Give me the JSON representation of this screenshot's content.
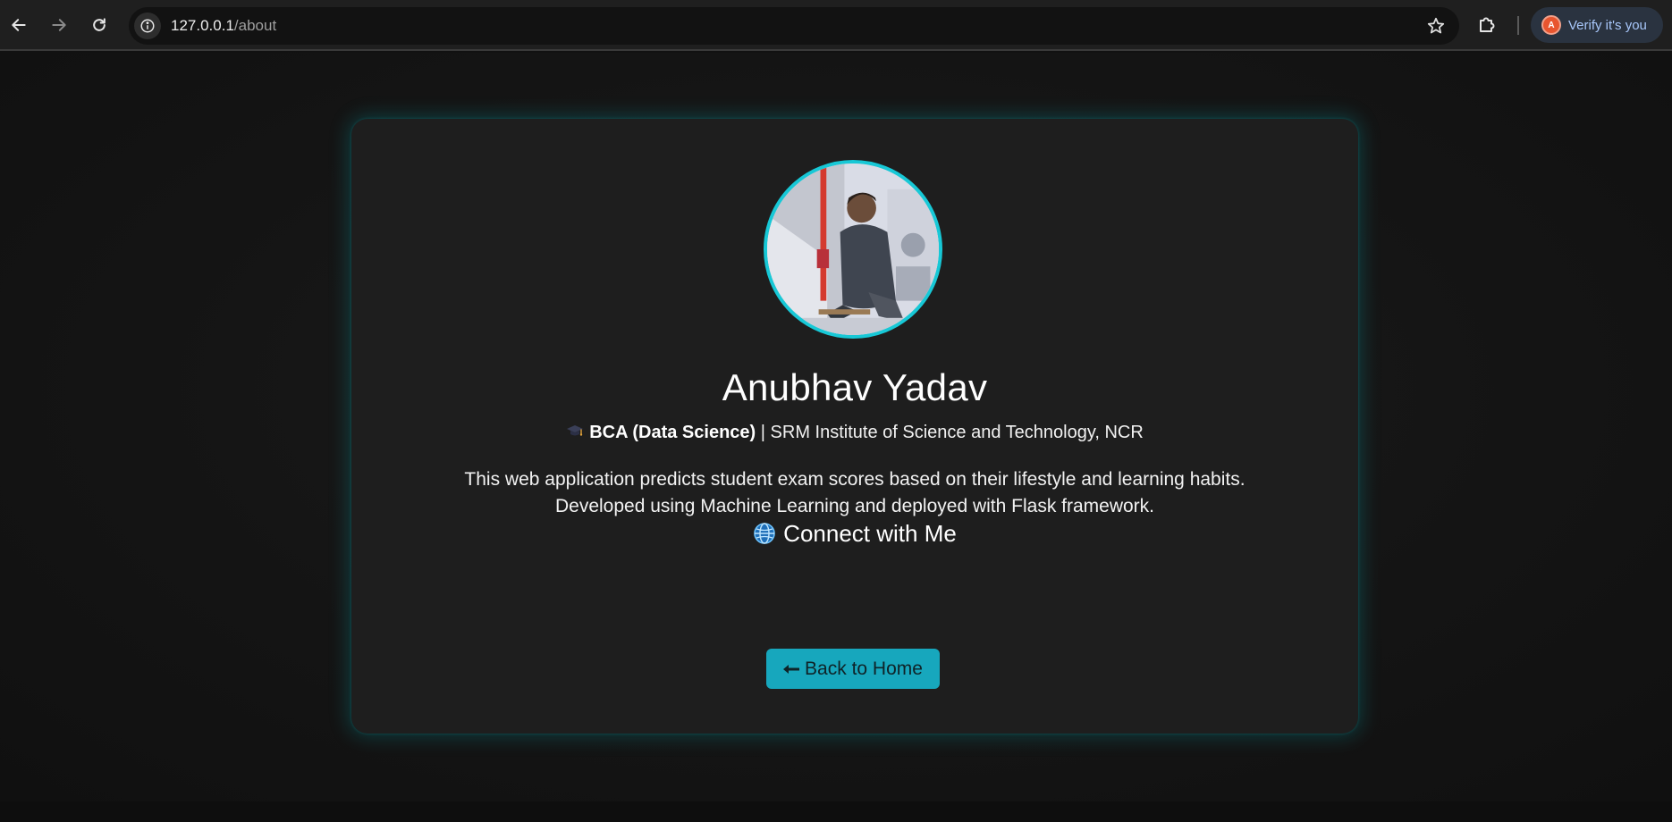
{
  "browser": {
    "url_host": "127.0.0.1",
    "url_path": "/about",
    "profile_initial": "A",
    "profile_label": "Verify it's you",
    "icons": {
      "back": "arrow-left-icon",
      "forward": "arrow-right-icon",
      "reload": "reload-icon",
      "site_info": "info-icon",
      "bookmark": "star-icon",
      "extensions": "puzzle-icon"
    }
  },
  "profile_card": {
    "name": "Anubhav Yadav",
    "degree": "BCA (Data Science)",
    "separator": "|",
    "institution": "SRM Institute of Science and Technology, NCR",
    "description_line1": "This web application predicts student exam scores based on their lifestyle and learning habits.",
    "description_line2": "Developed using Machine Learning and deployed with Flask framework.",
    "connect_heading": "Connect with Me",
    "back_button_label": "Back to Home"
  },
  "colors": {
    "accent": "#17c8d6",
    "button": "#17a7bd",
    "card_bg": "#1e1e1e",
    "page_bg": "#141414"
  }
}
